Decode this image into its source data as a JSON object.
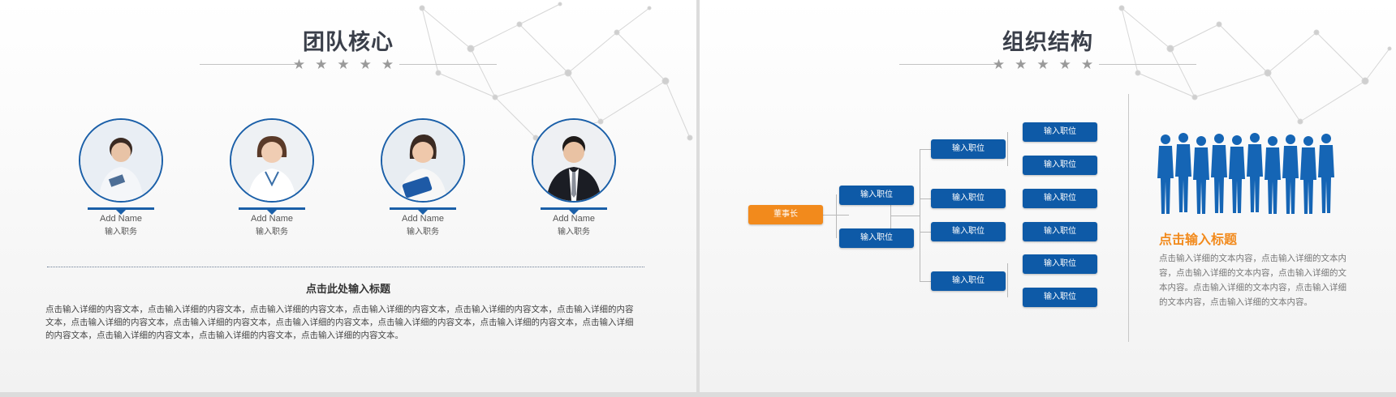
{
  "slide1": {
    "title": "团队核心",
    "stars": "★★★★★",
    "members": [
      {
        "name": "Add Name",
        "role": "输入职务"
      },
      {
        "name": "Add Name",
        "role": "输入职务"
      },
      {
        "name": "Add Name",
        "role": "输入职务"
      },
      {
        "name": "Add Name",
        "role": "输入职务"
      }
    ],
    "subtitle": "点击此处输入标题",
    "paragraph": "点击输入详细的内容文本，点击输入详细的内容文本，点击输入详细的内容文本，点击输入详细的内容文本，点击输入详细的内容文本，点击输入详细的内容文本，点击输入详细的内容文本，点击输入详细的内容文本，点击输入详细的内容文本，点击输入详细的内容文本，点击输入详细的内容文本，点击输入详细的内容文本，点击输入详细的内容文本，点击输入详细的内容文本，点击输入详细的内容文本。"
  },
  "slide2": {
    "title": "组织结构",
    "stars": "★★★★★",
    "ceo": "董事长",
    "level1": [
      "输入职位",
      "输入职位"
    ],
    "level2": [
      "输入职位",
      "输入职位",
      "输入职位",
      "输入职位"
    ],
    "level3": [
      "输入职位",
      "输入职位",
      "输入职位",
      "输入职位",
      "输入职位",
      "输入职位"
    ],
    "side_title": "点击输入标题",
    "side_text": "点击输入详细的文本内容，点击输入详细的文本内容，点击输入详细的文本内容，点击输入详细的文本内容。点击输入详细的文本内容，点击输入详细的文本内容，点击输入详细的文本内容。"
  },
  "colors": {
    "accent_blue": "#0e5aa7",
    "accent_orange": "#f28a1c",
    "title": "#3a3f4a"
  }
}
